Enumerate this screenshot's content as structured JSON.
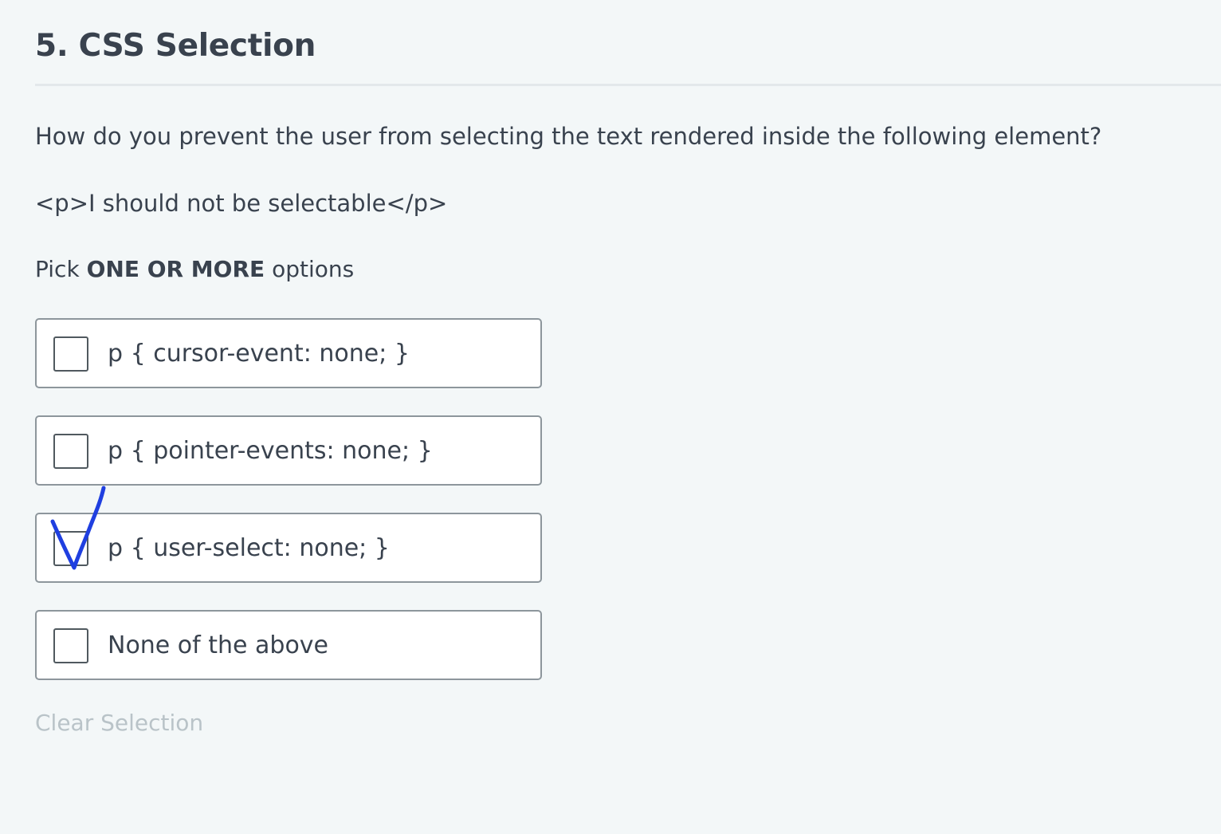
{
  "question": {
    "title": "5. CSS Selection",
    "prompt": "How do you prevent the user from selecting the text rendered inside the following element?",
    "code": "<p>I should not be selectable</p>",
    "pick_prefix": "Pick",
    "pick_emphasis": "ONE OR MORE",
    "pick_suffix": "options"
  },
  "options": [
    {
      "label": "p { cursor-event: none; }",
      "checked": false
    },
    {
      "label": "p { pointer-events: none; }",
      "checked": false
    },
    {
      "label": "p { user-select: none; }",
      "checked": false
    },
    {
      "label": "None of the above",
      "checked": false
    }
  ],
  "clear_label": "Clear Selection",
  "annotation": {
    "type": "handwritten-checkmark-icon",
    "target_option": "p { user-select: none; }",
    "color": "#1f3fe0"
  },
  "colors": {
    "background": "#f3f7f8",
    "text": "#39424e",
    "option_border": "#8d969c",
    "clear_text": "#b9c3c8"
  }
}
